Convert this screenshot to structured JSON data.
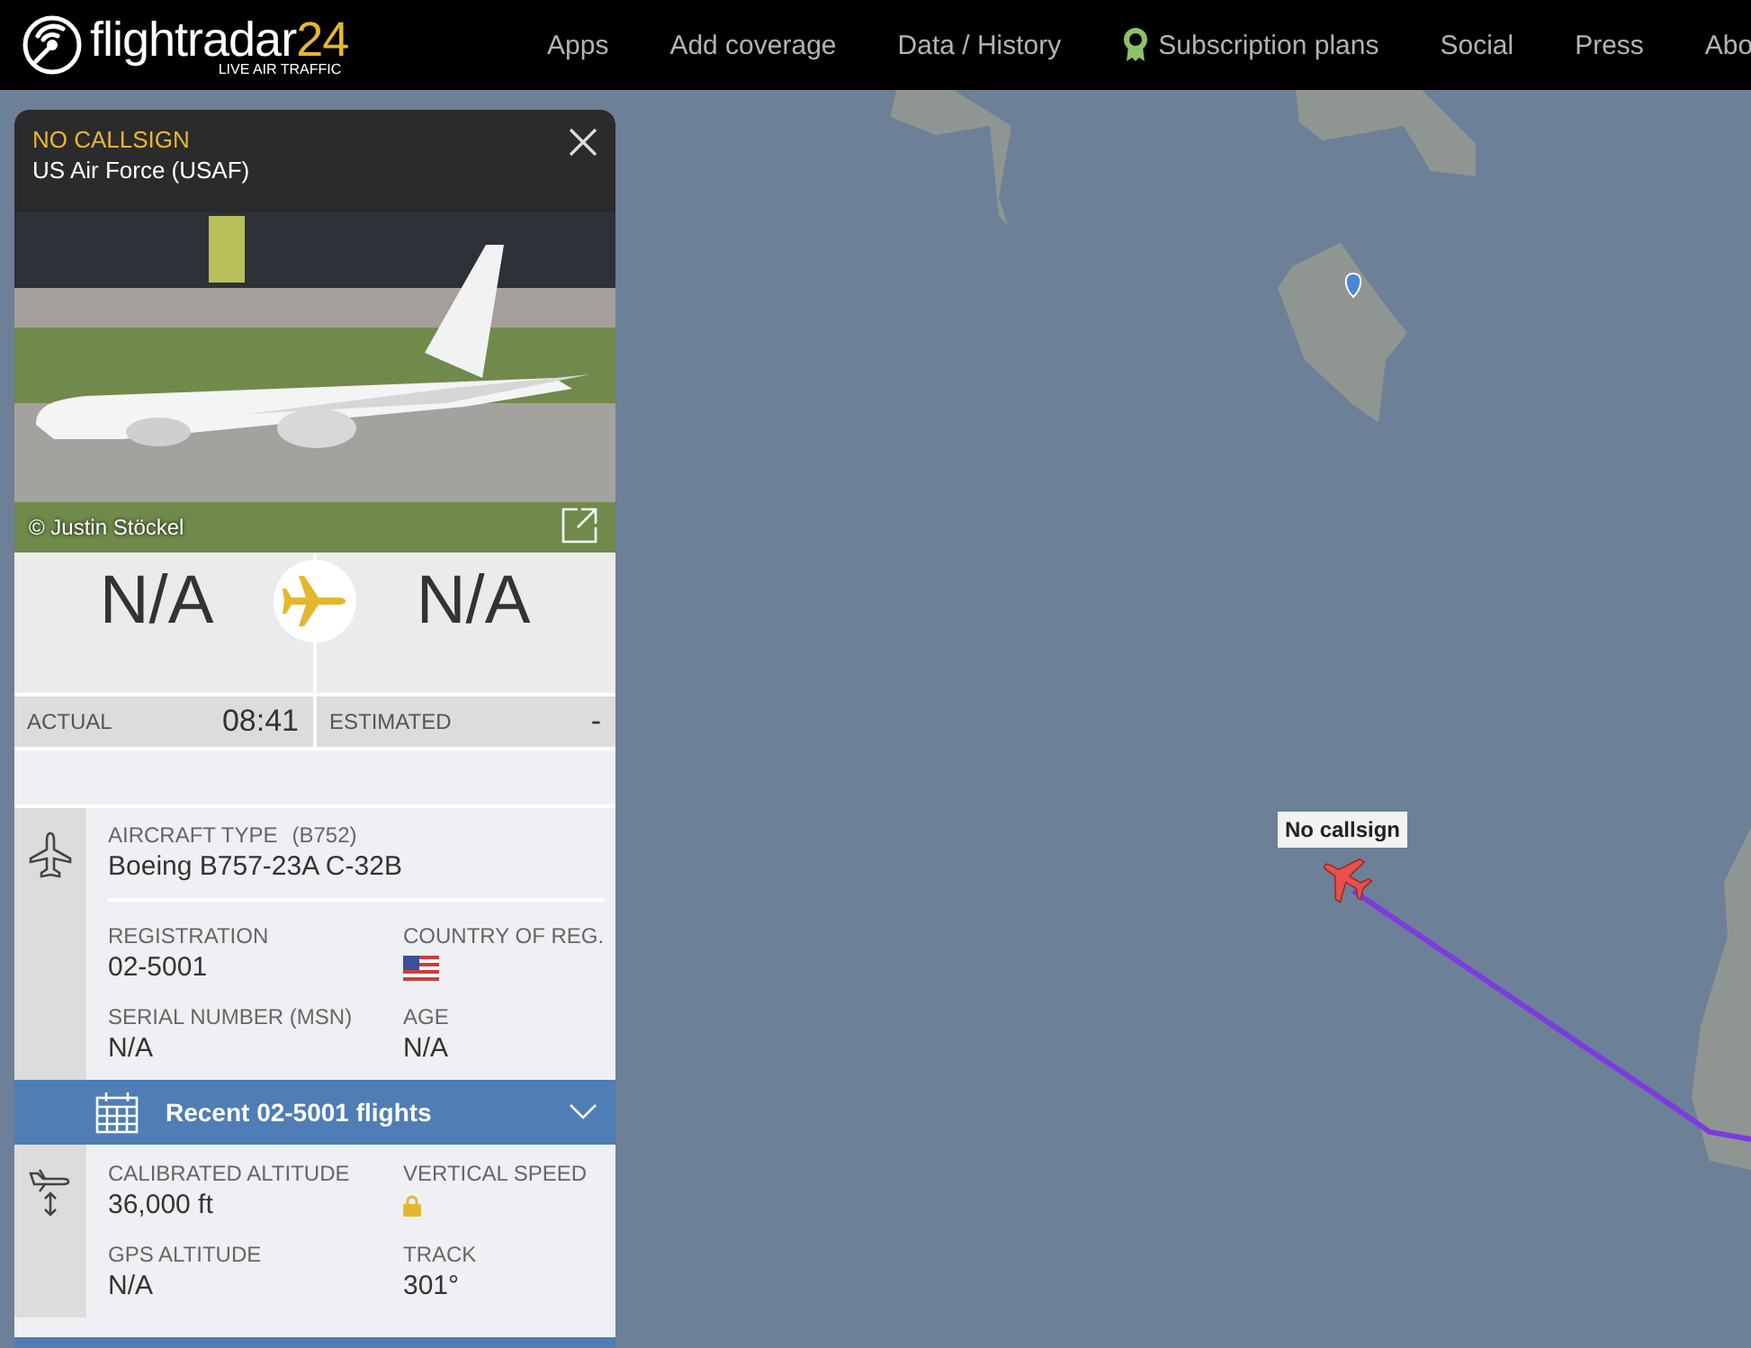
{
  "header": {
    "logo": {
      "wordmark": "flightradar",
      "number": "24",
      "tagline": "LIVE AIR TRAFFIC"
    },
    "nav": [
      {
        "label": "Apps",
        "kind": "plain"
      },
      {
        "label": "Add coverage",
        "kind": "plain"
      },
      {
        "label": "Data / History",
        "kind": "plain"
      },
      {
        "label": "Subscription plans",
        "kind": "award"
      },
      {
        "label": "Social",
        "kind": "plain"
      },
      {
        "label": "Press",
        "kind": "plain"
      },
      {
        "label": "Abo",
        "kind": "plain"
      }
    ]
  },
  "panel": {
    "callsign": "NO CALLSIGN",
    "airline": "US Air Force (USAF)",
    "photo_credit": "© Justin Stöckel",
    "origin": "N/A",
    "destination": "N/A",
    "times": [
      {
        "label": "ACTUAL",
        "value": "08:41"
      },
      {
        "label": "ESTIMATED",
        "value": "-"
      }
    ],
    "aircraft": {
      "type_label": "AIRCRAFT TYPE",
      "type_code": "(B752)",
      "type": "Boeing B757-23A C-32B",
      "fields": [
        {
          "label": "REGISTRATION",
          "value": "02-5001",
          "kind": "text"
        },
        {
          "label": "COUNTRY OF REG.",
          "kind": "flag"
        },
        {
          "label": "SERIAL NUMBER (MSN)",
          "value": "N/A",
          "kind": "text"
        },
        {
          "label": "AGE",
          "value": "N/A",
          "kind": "text"
        }
      ]
    },
    "recent_flights": {
      "label": "Recent 02-5001 flights",
      "expanded": false
    },
    "flight": {
      "fields": [
        {
          "label": "CALIBRATED ALTITUDE",
          "value": "36,000 ft",
          "kind": "text"
        },
        {
          "label": "VERTICAL SPEED",
          "kind": "locked"
        },
        {
          "label": "GPS ALTITUDE",
          "value": "N/A",
          "kind": "text"
        },
        {
          "label": "TRACK",
          "value": "301°",
          "kind": "text"
        }
      ]
    }
  },
  "map": {
    "marker_label": "No callsign"
  }
}
